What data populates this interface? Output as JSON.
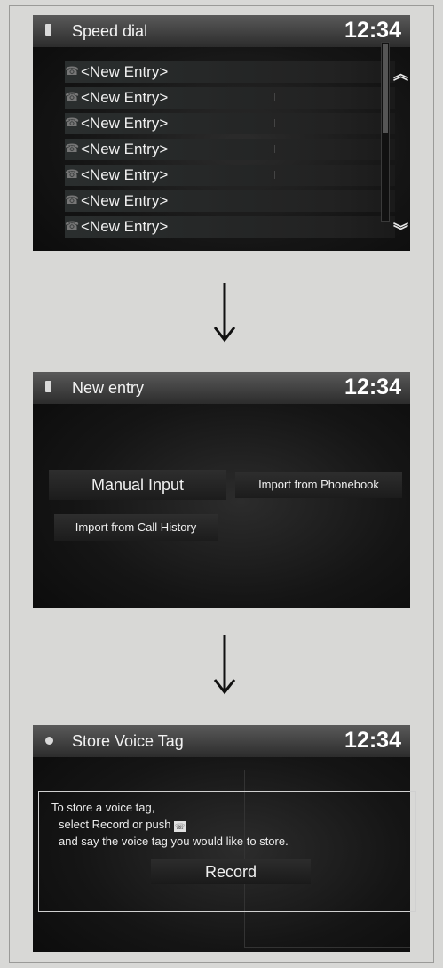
{
  "clock": "12:34",
  "speed_dial": {
    "title": "Speed dial",
    "entries": [
      "<New Entry>",
      "<New Entry>",
      "<New Entry>",
      "<New Entry>",
      "<New Entry>",
      "<New Entry>",
      "<New Entry>"
    ]
  },
  "new_entry": {
    "title": "New entry",
    "manual_input": "Manual Input",
    "import_phonebook": "Import from Phonebook",
    "import_call_history": "Import from Call History"
  },
  "store_voice_tag": {
    "title": "Store Voice Tag",
    "line1": "To store a voice tag,",
    "line2": "select Record or push",
    "line3": "and say the voice tag you would like to store.",
    "record_label": "Record"
  },
  "icons": [
    "phone-icon",
    "handset-icon",
    "scroll-up-icon",
    "scroll-down-icon",
    "talk-button-icon",
    "down-arrow-icon"
  ]
}
